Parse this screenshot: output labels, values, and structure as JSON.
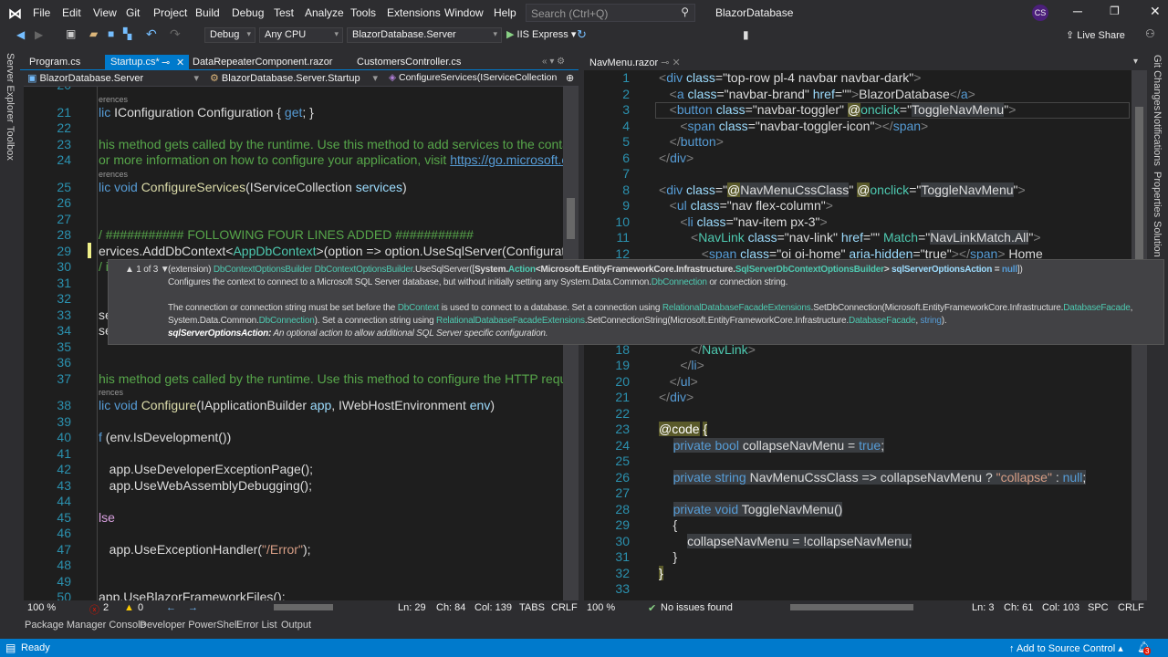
{
  "titlebar": {
    "menu": [
      "File",
      "Edit",
      "View",
      "Git",
      "Project",
      "Build",
      "Debug",
      "Test",
      "Analyze",
      "Tools",
      "Extensions",
      "Window",
      "Help"
    ],
    "search_placeholder": "Search (Ctrl+Q)",
    "solution": "BlazorDatabase",
    "avatar": "CS"
  },
  "toolbar": {
    "config": "Debug",
    "platform": "Any CPU",
    "startup": "BlazorDatabase.Server",
    "run": "IIS Express",
    "live_share": "Live Share"
  },
  "side_left": [
    "Server Explorer",
    "Toolbox"
  ],
  "side_right": [
    "Git Changes",
    "Notifications",
    "Properties",
    "Solution Explorer"
  ],
  "left_pane": {
    "tabs": [
      "Program.cs",
      "Startup.cs*",
      "DataRepeaterComponent.razor",
      "CustomersController.cs"
    ],
    "nav": [
      "BlazorDatabase.Server",
      "BlazorDatabase.Server.Startup",
      "ConfigureServices(IServiceCollection"
    ],
    "lines": [
      {
        "n": "21",
        "lens": "erences",
        "seg": [
          [
            "k",
            "lic "
          ],
          [
            "p",
            "IConfiguration Configuration { "
          ],
          [
            "k",
            "get"
          ],
          [
            "p",
            "; }"
          ]
        ]
      },
      {
        "n": "22",
        "seg": []
      },
      {
        "n": "23",
        "seg": [
          [
            "c",
            "his method gets called by the runtime. Use this method to add services to the container."
          ]
        ]
      },
      {
        "n": "24",
        "seg": [
          [
            "c",
            "or more information on how to configure your application, visit "
          ],
          [
            "l",
            "https://go.microsoft.com/"
          ]
        ]
      },
      {
        "n": "25",
        "lens": "erences",
        "seg": [
          [
            "k",
            "lic void "
          ],
          [
            "m",
            "ConfigureServices"
          ],
          [
            "p",
            "(IServiceCollection "
          ],
          [
            "v",
            "services"
          ],
          [
            "p",
            ")"
          ]
        ]
      },
      {
        "n": "26",
        "seg": []
      },
      {
        "n": "27",
        "seg": []
      },
      {
        "n": "28",
        "seg": [
          [
            "c",
            "/ ########### FOLLOWING FOUR LINES ADDED ###########"
          ]
        ]
      },
      {
        "n": "29",
        "seg": [
          [
            "p",
            "ervices.AddDbContext<"
          ],
          [
            "t",
            "AppDbContext"
          ],
          [
            "p",
            ">(option => option.UseSqlServer(Configuration.)"
          ]
        ]
      },
      {
        "n": "30",
        "seg": [
          [
            "c",
            "/ i"
          ]
        ]
      },
      {
        "n": "31",
        "seg": []
      },
      {
        "n": "32",
        "seg": []
      },
      {
        "n": "33",
        "seg": [
          [
            "p",
            "se"
          ]
        ]
      },
      {
        "n": "34",
        "seg": [
          [
            "p",
            "se"
          ]
        ]
      },
      {
        "n": "35",
        "seg": []
      },
      {
        "n": "36",
        "seg": []
      },
      {
        "n": "37",
        "seg": [
          [
            "c",
            "his method gets called by the runtime. Use this method to configure the HTTP request pipeline."
          ]
        ]
      },
      {
        "n": "38",
        "lens": "rences",
        "seg": [
          [
            "k",
            "lic void "
          ],
          [
            "m",
            "Configure"
          ],
          [
            "p",
            "(IApplicationBuilder "
          ],
          [
            "v",
            "app"
          ],
          [
            "p",
            ", IWebHostEnvironment "
          ],
          [
            "v",
            "env"
          ],
          [
            "p",
            ")"
          ]
        ]
      },
      {
        "n": "39",
        "seg": []
      },
      {
        "n": "40",
        "seg": [
          [
            "k",
            "f"
          ],
          [
            "p",
            " (env.IsDevelopment())"
          ]
        ]
      },
      {
        "n": "41",
        "seg": []
      },
      {
        "n": "42",
        "seg": [
          [
            "p",
            "   app.UseDeveloperExceptionPage();"
          ]
        ]
      },
      {
        "n": "43",
        "seg": [
          [
            "p",
            "   app.UseWebAssemblyDebugging();"
          ]
        ]
      },
      {
        "n": "44",
        "seg": []
      },
      {
        "n": "45",
        "seg": [
          [
            "kc",
            "lse"
          ]
        ]
      },
      {
        "n": "46",
        "seg": []
      },
      {
        "n": "47",
        "seg": [
          [
            "p",
            "   app.UseExceptionHandler("
          ],
          [
            "s",
            "\"/Error\""
          ],
          [
            "p",
            ");"
          ]
        ]
      },
      {
        "n": "48",
        "seg": []
      },
      {
        "n": "49",
        "seg": []
      },
      {
        "n": "50",
        "seg": [
          [
            "p",
            "app.UseBlazorFrameworkFiles();"
          ]
        ]
      }
    ],
    "status": {
      "zoom": "100 %",
      "errors": "2",
      "warnings": "0",
      "ln": "Ln: 29",
      "ch": "Ch: 84",
      "col": "Col: 139",
      "tabs": "TABS",
      "eol": "CRLF"
    }
  },
  "tooltip": {
    "counter": "1 of 3",
    "lines": [
      [
        [
          "p",
          "(extension) "
        ],
        [
          "t",
          "DbContextOptionsBuilder DbContextOptionsBuilder"
        ],
        [
          "p",
          ".UseSqlServer(["
        ],
        [
          "b",
          "System."
        ],
        [
          "bt",
          "Action"
        ],
        [
          "b",
          "<Microsoft.EntityFrameworkCore.Infrastructure."
        ],
        [
          "bt",
          "SqlServerDbContextOptionsBuilder"
        ],
        [
          "b",
          "> "
        ],
        [
          "bv",
          "sqlServerOptionsAction"
        ],
        [
          "b",
          " = "
        ],
        [
          "bk",
          "null"
        ],
        [
          "p",
          "])"
        ]
      ],
      [
        [
          "p",
          "Configures the context to connect to a Microsoft SQL Server database, but without initially setting any System.Data.Common."
        ],
        [
          "t",
          "DbConnection"
        ],
        [
          "p",
          " or connection string."
        ]
      ],
      [],
      [
        [
          "p",
          "The connection or connection string must be set before the "
        ],
        [
          "t",
          "DbContext"
        ],
        [
          "p",
          " is used to connect to a database. Set a connection using "
        ],
        [
          "t",
          "RelationalDatabaseFacadeExtensions"
        ],
        [
          "p",
          ".SetDbConnection(Microsoft.EntityFrameworkCore.Infrastructure."
        ],
        [
          "t",
          "DatabaseFacade"
        ],
        [
          "p",
          ","
        ]
      ],
      [
        [
          "p",
          "System.Data.Common."
        ],
        [
          "t",
          "DbConnection"
        ],
        [
          "p",
          "). Set a connection string using "
        ],
        [
          "t",
          "RelationalDatabaseFacadeExtensions"
        ],
        [
          "p",
          ".SetConnectionString(Microsoft.EntityFrameworkCore.Infrastructure."
        ],
        [
          "t",
          "DatabaseFacade"
        ],
        [
          "p",
          ", "
        ],
        [
          "k",
          "string"
        ],
        [
          "p",
          ")."
        ]
      ],
      [
        [
          "bi",
          "sqlServerOptionsAction:"
        ],
        [
          "i",
          " An optional action to allow additional SQL Server specific configuration."
        ]
      ]
    ]
  },
  "right_pane": {
    "tab": "NavMenu.razor",
    "lines": [
      {
        "n": "1",
        "seg": [
          [
            "g",
            "<"
          ],
          [
            "k",
            "div "
          ],
          [
            "v",
            "class"
          ],
          [
            "p",
            "=\"top-row pl-4 navbar navbar-dark\""
          ],
          [
            "g",
            ">"
          ]
        ]
      },
      {
        "n": "2",
        "seg": [
          [
            "p",
            "   "
          ],
          [
            "g",
            "<"
          ],
          [
            "k",
            "a "
          ],
          [
            "v",
            "class"
          ],
          [
            "p",
            "=\"navbar-brand\" "
          ],
          [
            "v",
            "href"
          ],
          [
            "p",
            "=\"\""
          ],
          [
            "g",
            ">"
          ],
          [
            "p",
            "BlazorDatabase"
          ],
          [
            "g",
            "</"
          ],
          [
            "k",
            "a"
          ],
          [
            "g",
            ">"
          ]
        ]
      },
      {
        "n": "3",
        "seg": [
          [
            "p",
            "   "
          ],
          [
            "g",
            "<"
          ],
          [
            "k",
            "button "
          ],
          [
            "v",
            "class"
          ],
          [
            "p",
            "=\"navbar-toggler\" "
          ],
          [
            "at",
            "@"
          ],
          [
            "t",
            "onclick"
          ],
          [
            "p",
            "=\""
          ],
          [
            "hl",
            "ToggleNavMenu"
          ],
          [
            "p",
            "\""
          ],
          [
            "g",
            ">"
          ]
        ]
      },
      {
        "n": "4",
        "seg": [
          [
            "p",
            "      "
          ],
          [
            "g",
            "<"
          ],
          [
            "k",
            "span "
          ],
          [
            "v",
            "class"
          ],
          [
            "p",
            "=\"navbar-toggler-icon\""
          ],
          [
            "g",
            "></"
          ],
          [
            "k",
            "span"
          ],
          [
            "g",
            ">"
          ]
        ]
      },
      {
        "n": "5",
        "seg": [
          [
            "p",
            "   "
          ],
          [
            "g",
            "</"
          ],
          [
            "k",
            "button"
          ],
          [
            "g",
            ">"
          ]
        ]
      },
      {
        "n": "6",
        "seg": [
          [
            "g",
            "</"
          ],
          [
            "k",
            "div"
          ],
          [
            "g",
            ">"
          ]
        ]
      },
      {
        "n": "7",
        "seg": []
      },
      {
        "n": "8",
        "seg": [
          [
            "g",
            "<"
          ],
          [
            "k",
            "div "
          ],
          [
            "v",
            "class"
          ],
          [
            "p",
            "=\""
          ],
          [
            "at",
            "@"
          ],
          [
            "hl",
            "NavMenuCssClass"
          ],
          [
            "p",
            "\" "
          ],
          [
            "at",
            "@"
          ],
          [
            "t",
            "onclick"
          ],
          [
            "p",
            "=\""
          ],
          [
            "hl",
            "ToggleNavMenu"
          ],
          [
            "p",
            "\""
          ],
          [
            "g",
            ">"
          ]
        ]
      },
      {
        "n": "9",
        "seg": [
          [
            "p",
            "   "
          ],
          [
            "g",
            "<"
          ],
          [
            "k",
            "ul "
          ],
          [
            "v",
            "class"
          ],
          [
            "p",
            "=\"nav flex-column\""
          ],
          [
            "g",
            ">"
          ]
        ]
      },
      {
        "n": "10",
        "seg": [
          [
            "p",
            "      "
          ],
          [
            "g",
            "<"
          ],
          [
            "k",
            "li "
          ],
          [
            "v",
            "class"
          ],
          [
            "p",
            "=\"nav-item px-3\""
          ],
          [
            "g",
            ">"
          ]
        ]
      },
      {
        "n": "11",
        "seg": [
          [
            "p",
            "         "
          ],
          [
            "g",
            "<"
          ],
          [
            "t",
            "NavLink "
          ],
          [
            "v",
            "class"
          ],
          [
            "p",
            "=\"nav-link\" "
          ],
          [
            "v",
            "href"
          ],
          [
            "p",
            "=\"\" "
          ],
          [
            "t",
            "Match"
          ],
          [
            "p",
            "=\""
          ],
          [
            "hl",
            "NavLinkMatch.All"
          ],
          [
            "p",
            "\""
          ],
          [
            "g",
            ">"
          ]
        ]
      },
      {
        "n": "12",
        "seg": [
          [
            "p",
            "            "
          ],
          [
            "g",
            "<"
          ],
          [
            "k",
            "span "
          ],
          [
            "v",
            "class"
          ],
          [
            "p",
            "=\"oi oi-home\" "
          ],
          [
            "v",
            "aria-hidden"
          ],
          [
            "p",
            "=\"true\""
          ],
          [
            "g",
            "></"
          ],
          [
            "k",
            "span"
          ],
          [
            "g",
            "> "
          ],
          [
            "p",
            "Home"
          ]
        ]
      },
      {
        "n": "13",
        "seg": []
      },
      {
        "n": "14",
        "seg": []
      },
      {
        "n": "15",
        "seg": []
      },
      {
        "n": "16",
        "seg": []
      },
      {
        "n": "17",
        "seg": []
      },
      {
        "n": "18",
        "seg": [
          [
            "p",
            "         "
          ],
          [
            "g",
            "</"
          ],
          [
            "t",
            "NavLink"
          ],
          [
            "g",
            ">"
          ]
        ]
      },
      {
        "n": "19",
        "seg": [
          [
            "p",
            "      "
          ],
          [
            "g",
            "</"
          ],
          [
            "k",
            "li"
          ],
          [
            "g",
            ">"
          ]
        ]
      },
      {
        "n": "20",
        "seg": [
          [
            "p",
            "   "
          ],
          [
            "g",
            "</"
          ],
          [
            "k",
            "ul"
          ],
          [
            "g",
            ">"
          ]
        ]
      },
      {
        "n": "21",
        "seg": [
          [
            "g",
            "</"
          ],
          [
            "k",
            "div"
          ],
          [
            "g",
            ">"
          ]
        ]
      },
      {
        "n": "22",
        "seg": []
      },
      {
        "n": "23",
        "seg": [
          [
            "at",
            "@code"
          ],
          [
            "p",
            " "
          ],
          [
            "at",
            "{"
          ]
        ]
      },
      {
        "n": "24",
        "seg": [
          [
            "p",
            "    "
          ],
          [
            "hk",
            "private bool "
          ],
          [
            "hl",
            "collapseNavMenu = "
          ],
          [
            "hk",
            "true"
          ],
          [
            "hl",
            ";"
          ]
        ]
      },
      {
        "n": "25",
        "seg": []
      },
      {
        "n": "26",
        "seg": [
          [
            "p",
            "    "
          ],
          [
            "hk",
            "private string "
          ],
          [
            "hl",
            "NavMenuCssClass => collapseNavMenu ? "
          ],
          [
            "hs",
            "\"collapse\""
          ],
          [
            "hl",
            " : "
          ],
          [
            "hk",
            "null"
          ],
          [
            "hl",
            ";"
          ]
        ]
      },
      {
        "n": "27",
        "seg": []
      },
      {
        "n": "28",
        "seg": [
          [
            "p",
            "    "
          ],
          [
            "hk",
            "private void "
          ],
          [
            "hl",
            "ToggleNavMenu()"
          ]
        ]
      },
      {
        "n": "29",
        "seg": [
          [
            "p",
            "    {"
          ]
        ]
      },
      {
        "n": "30",
        "seg": [
          [
            "p",
            "        "
          ],
          [
            "hl",
            "collapseNavMenu = !collapseNavMenu;"
          ]
        ]
      },
      {
        "n": "31",
        "seg": [
          [
            "p",
            "    }"
          ]
        ]
      },
      {
        "n": "32",
        "seg": [
          [
            "at",
            "}"
          ]
        ]
      },
      {
        "n": "33",
        "seg": []
      }
    ],
    "status": {
      "zoom": "100 %",
      "issues": "No issues found",
      "ln": "Ln: 3",
      "ch": "Ch: 61",
      "col": "Col: 103",
      "spc": "SPC",
      "eol": "CRLF"
    }
  },
  "bottom_tabs": [
    "Package Manager Console",
    "Developer PowerShell",
    "Error List",
    "Output"
  ],
  "statusbar": {
    "ready": "Ready",
    "source_control": "Add to Source Control",
    "notifications": "3"
  }
}
